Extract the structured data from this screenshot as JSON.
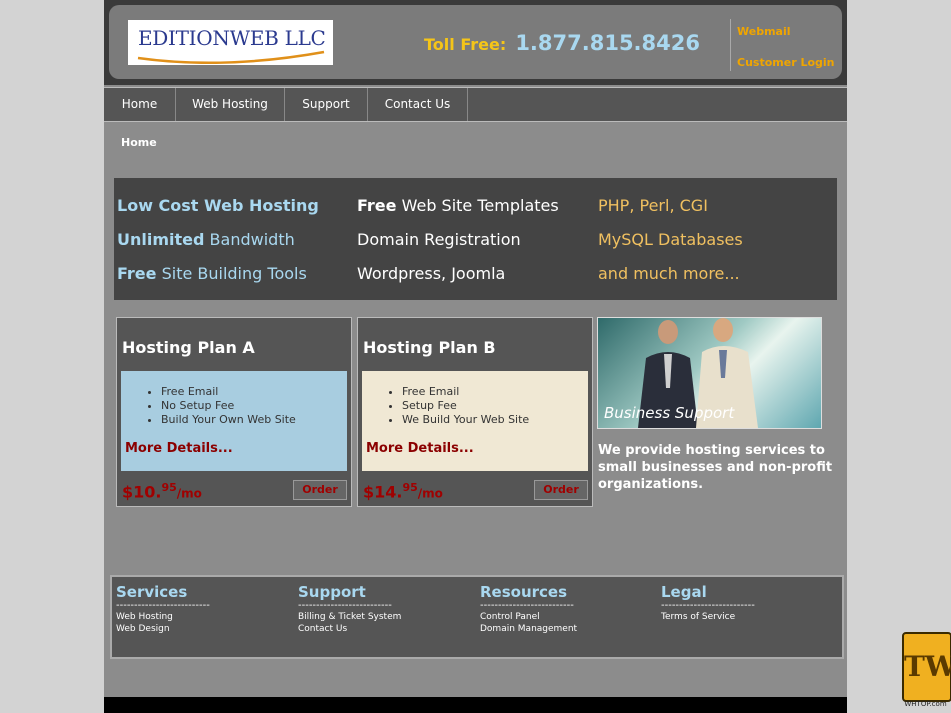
{
  "header": {
    "logo_text": "EDITIONWEB LLC",
    "toll_free_label": "Toll Free:",
    "toll_free_number": "1.877.815.8426",
    "links": [
      "Webmail",
      "Customer Login"
    ]
  },
  "nav": [
    "Home",
    "Web Hosting",
    "Support",
    "Contact Us"
  ],
  "breadcrumb": "Home",
  "features": {
    "col1": [
      {
        "bold": "Low Cost Web Hosting",
        "rest": ""
      },
      {
        "bold": "Unlimited",
        "rest": " Bandwidth"
      },
      {
        "bold": "Free",
        "rest": " Site Building Tools"
      }
    ],
    "col2": [
      {
        "bold": "Free",
        "rest": " Web Site Templates"
      },
      {
        "bold": "",
        "rest": "Domain Registration"
      },
      {
        "bold": "",
        "rest": "Wordpress, Joomla"
      }
    ],
    "col3": [
      "PHP, Perl, CGI",
      "MySQL Databases",
      "and much more..."
    ]
  },
  "plans": [
    {
      "title": "Hosting Plan A",
      "items": [
        "Free Email",
        "No Setup Fee",
        "Build Your Own Web Site"
      ],
      "more": "More Details...",
      "price_dollars": "$10.",
      "price_cents": "95",
      "price_unit": "/mo",
      "order": "Order",
      "box_color": "#a8cde0"
    },
    {
      "title": "Hosting Plan B",
      "items": [
        "Free Email",
        "Setup Fee",
        "We Build Your Web Site"
      ],
      "more": "More Details...",
      "price_dollars": "$14.",
      "price_cents": "95",
      "price_unit": "/mo",
      "order": "Order",
      "box_color": "#f0e8d4"
    }
  ],
  "business_image_caption": "Business Support",
  "description": "We provide hosting services to small businesses and non-profit organizations.",
  "footer": [
    {
      "heading": "Services",
      "links": [
        "Web Hosting",
        "Web Design"
      ]
    },
    {
      "heading": "Support",
      "links": [
        "Billing & Ticket System",
        "Contact Us"
      ]
    },
    {
      "heading": "Resources",
      "links": [
        "Control Panel",
        "Domain Management"
      ]
    },
    {
      "heading": "Legal",
      "links": [
        "Terms of Service"
      ]
    }
  ],
  "footer_divider": "--------------------------",
  "badge": {
    "letters": "TW",
    "site": "WHTOP.com"
  }
}
